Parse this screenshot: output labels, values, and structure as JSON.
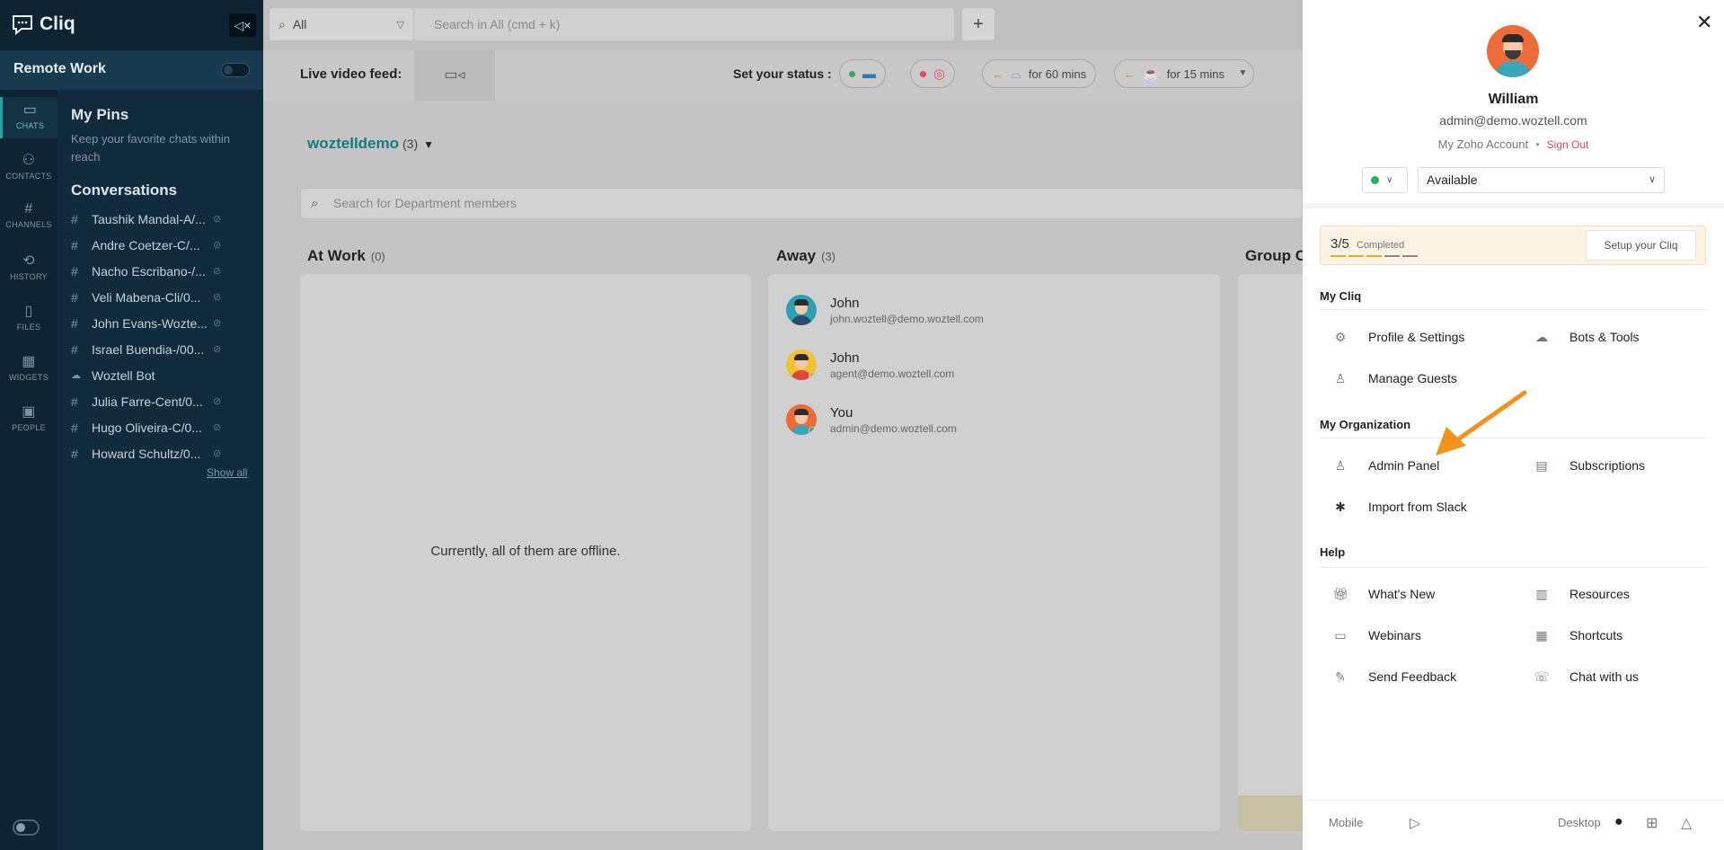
{
  "app": {
    "name": "Cliq"
  },
  "rail": {
    "items": [
      {
        "label": "CHATS",
        "icon": "chat-icon"
      },
      {
        "label": "CONTACTS",
        "icon": "contacts-icon"
      },
      {
        "label": "CHANNELS",
        "icon": "hash-icon"
      },
      {
        "label": "HISTORY",
        "icon": "history-icon"
      },
      {
        "label": "FILES",
        "icon": "file-icon"
      },
      {
        "label": "WIDGETS",
        "icon": "widgets-icon"
      },
      {
        "label": "PEOPLE",
        "icon": "people-icon"
      }
    ]
  },
  "sidebar": {
    "workspace": "Remote Work",
    "pins_title": "My Pins",
    "pins_subtitle": "Keep your favorite chats within reach",
    "conversations_title": "Conversations",
    "conversations": [
      {
        "name": "Taushik Mandal-A/...",
        "icon": "#"
      },
      {
        "name": "Andre Coetzer-C/...",
        "icon": "#"
      },
      {
        "name": "Nacho Escribano-/...",
        "icon": "#"
      },
      {
        "name": "Veli Mabena-Cli/0...",
        "icon": "#"
      },
      {
        "name": "John Evans-Wozte...",
        "icon": "#"
      },
      {
        "name": "Israel Buendia-/00...",
        "icon": "#"
      },
      {
        "name": "Woztell Bot",
        "icon": "bot-icon"
      },
      {
        "name": "Julia Farre-Cent/0...",
        "icon": "#"
      },
      {
        "name": "Hugo Oliveira-C/0...",
        "icon": "#"
      },
      {
        "name": "Howard Schultz/0...",
        "icon": "#"
      }
    ],
    "show_all": "Show all"
  },
  "topbar": {
    "scope": "All",
    "search_placeholder": "Search in All (cmd + k)",
    "plus": "+"
  },
  "strip": {
    "live_label": "Live video feed:",
    "status_label": "Set your status :",
    "chips": [
      {
        "icon": "laptop-icon",
        "dot_color": "#27ae60"
      },
      {
        "icon": "target-icon",
        "dot_color": "#e5484d"
      },
      {
        "icon": "meal-icon",
        "text": "for 60 mins"
      },
      {
        "icon": "coffee-icon",
        "text": "for 15 mins"
      }
    ]
  },
  "main": {
    "department": "woztelldemo",
    "department_count": "(3)",
    "search_placeholder": "Search for Department members",
    "columns": [
      {
        "title": "At Work",
        "count": "(0)",
        "empty_text": "Currently, all of them are offline."
      },
      {
        "title": "Away",
        "count": "(3)"
      },
      {
        "title": "Group C"
      }
    ],
    "members": [
      {
        "name": "John",
        "email": "john.woztell@demo.woztell.com",
        "status_color": "",
        "avatar_bg": "#2f9fb3"
      },
      {
        "name": "John",
        "email": "agent@demo.woztell.com",
        "status_color": "#f0a030",
        "avatar_bg": "#f2c230"
      },
      {
        "name": "You",
        "email": "admin@demo.woztell.com",
        "status_color": "#27ae60",
        "avatar_bg": "#ee6b3a"
      }
    ]
  },
  "panel": {
    "name": "William",
    "email": "admin@demo.woztell.com",
    "my_account": "My Zoho Account",
    "sign_out": "Sign Out",
    "status_value": "Available",
    "status_color": "#27ae60",
    "setup": {
      "fraction": "3/5",
      "completed": "Completed",
      "button": "Setup your Cliq",
      "done": 3,
      "total": 5
    },
    "sections": {
      "my_cliq": "My Cliq",
      "my_org": "My Organization",
      "help": "Help"
    },
    "items": {
      "profile": "Profile & Settings",
      "bots": "Bots & Tools",
      "guests": "Manage Guests",
      "admin": "Admin Panel",
      "subscriptions": "Subscriptions",
      "slack": "Import from Slack",
      "whats_new": "What's New",
      "resources": "Resources",
      "webinars": "Webinars",
      "shortcuts": "Shortcuts",
      "feedback": "Send Feedback",
      "chat": "Chat with us"
    },
    "footer": {
      "mobile": "Mobile",
      "desktop": "Desktop"
    }
  },
  "colors": {
    "accent": "#157b7f",
    "annotation_arrow": "#f4921e",
    "danger": "#e5484d"
  }
}
